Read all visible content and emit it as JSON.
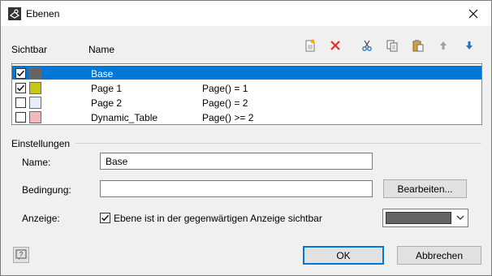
{
  "window": {
    "title": "Ebenen"
  },
  "header": {
    "visible_label": "Sichtbar",
    "name_label": "Name"
  },
  "layers": [
    {
      "name": "Base",
      "condition": "",
      "visible": true,
      "color": "#646464",
      "selected": true
    },
    {
      "name": "Page 1",
      "condition": "Page() = 1",
      "visible": true,
      "color": "#c7c70f",
      "selected": false
    },
    {
      "name": "Page 2",
      "condition": "Page() = 2",
      "visible": false,
      "color": "#e8eef8",
      "selected": false
    },
    {
      "name": "Dynamic_Table",
      "condition": "Page() >= 2",
      "visible": false,
      "color": "#f3b8b8",
      "selected": false
    }
  ],
  "settings": {
    "group_label": "Einstellungen",
    "name_label": "Name:",
    "name_value": "Base",
    "condition_label": "Bedingung:",
    "condition_value": "",
    "edit_button": "Bearbeiten...",
    "display_label": "Anzeige:",
    "visible_checkbox_label": "Ebene ist in der gegenwärtigen Anzeige sichtbar",
    "visible_checked": true,
    "display_color": "#646464"
  },
  "footer": {
    "ok": "OK",
    "cancel": "Abbrechen"
  },
  "icons": [
    "layers-icon",
    "close-icon",
    "new-layer-icon",
    "delete-icon",
    "cut-icon",
    "copy-icon",
    "paste-icon",
    "move-up-icon",
    "move-down-icon",
    "help-icon"
  ]
}
